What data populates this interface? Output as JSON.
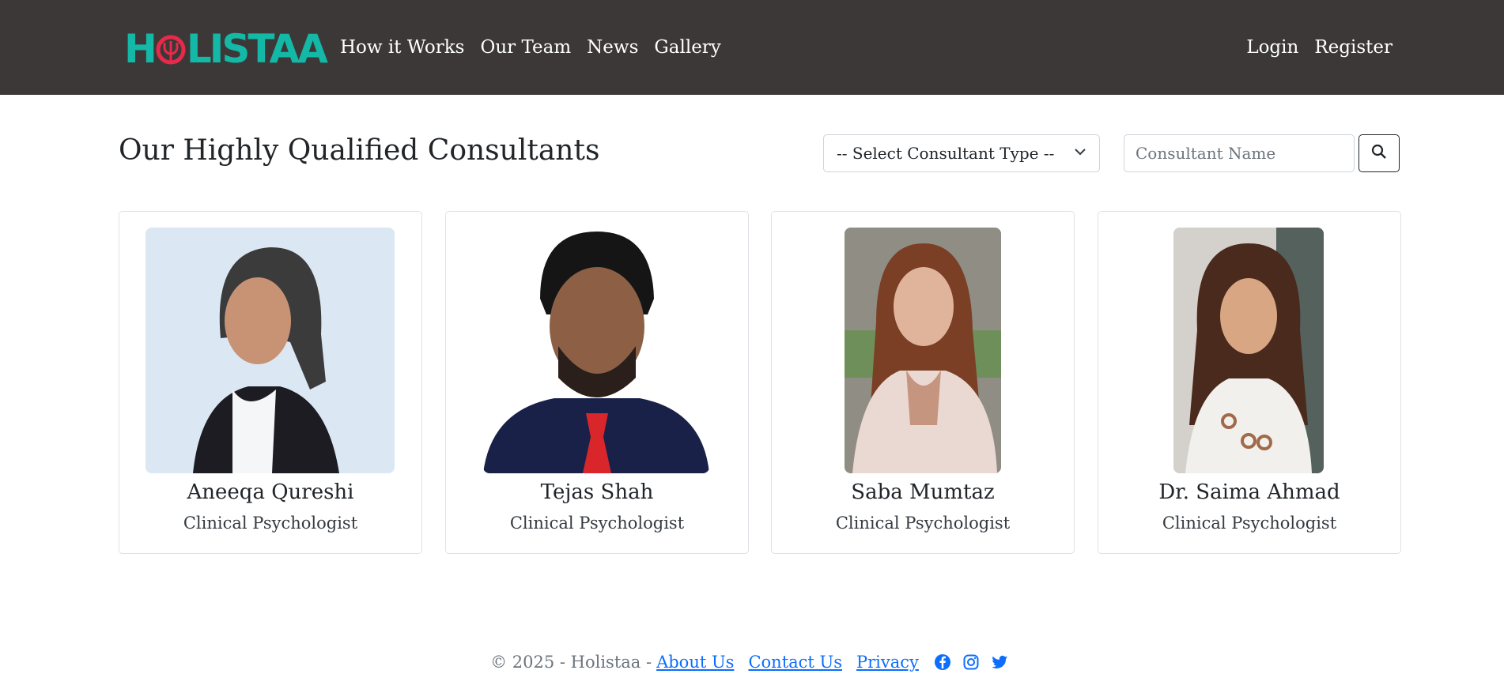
{
  "header": {
    "brand": "HOLISTAA",
    "nav_left": [
      "How it Works",
      "Our Team",
      "News",
      "Gallery"
    ],
    "nav_right": [
      "Login",
      "Register"
    ],
    "colors": {
      "background": "#3d3838",
      "logo_teal": "#13b8a6",
      "logo_red": "#e8294a"
    }
  },
  "main": {
    "title": "Our Highly Qualified Consultants",
    "select_type": {
      "selected": "-- Select Consultant Type --",
      "icon": "chevron-down-icon"
    },
    "search": {
      "placeholder": "Consultant Name",
      "value": "",
      "button_icon": "search-icon"
    }
  },
  "consultants": [
    {
      "name": "Aneeqa Qureshi",
      "role": "Clinical Psychologist"
    },
    {
      "name": "Tejas Shah",
      "role": "Clinical Psychologist"
    },
    {
      "name": "Saba Mumtaz",
      "role": "Clinical Psychologist"
    },
    {
      "name": "Dr. Saima Ahmad",
      "role": "Clinical Psychologist"
    }
  ],
  "footer": {
    "copyright": "© 2025 - Holistaa -",
    "links": [
      "About Us",
      "Contact Us",
      "Privacy"
    ],
    "social_icons": [
      "facebook-icon",
      "instagram-icon",
      "twitter-icon"
    ],
    "link_color": "#0d6efd"
  }
}
